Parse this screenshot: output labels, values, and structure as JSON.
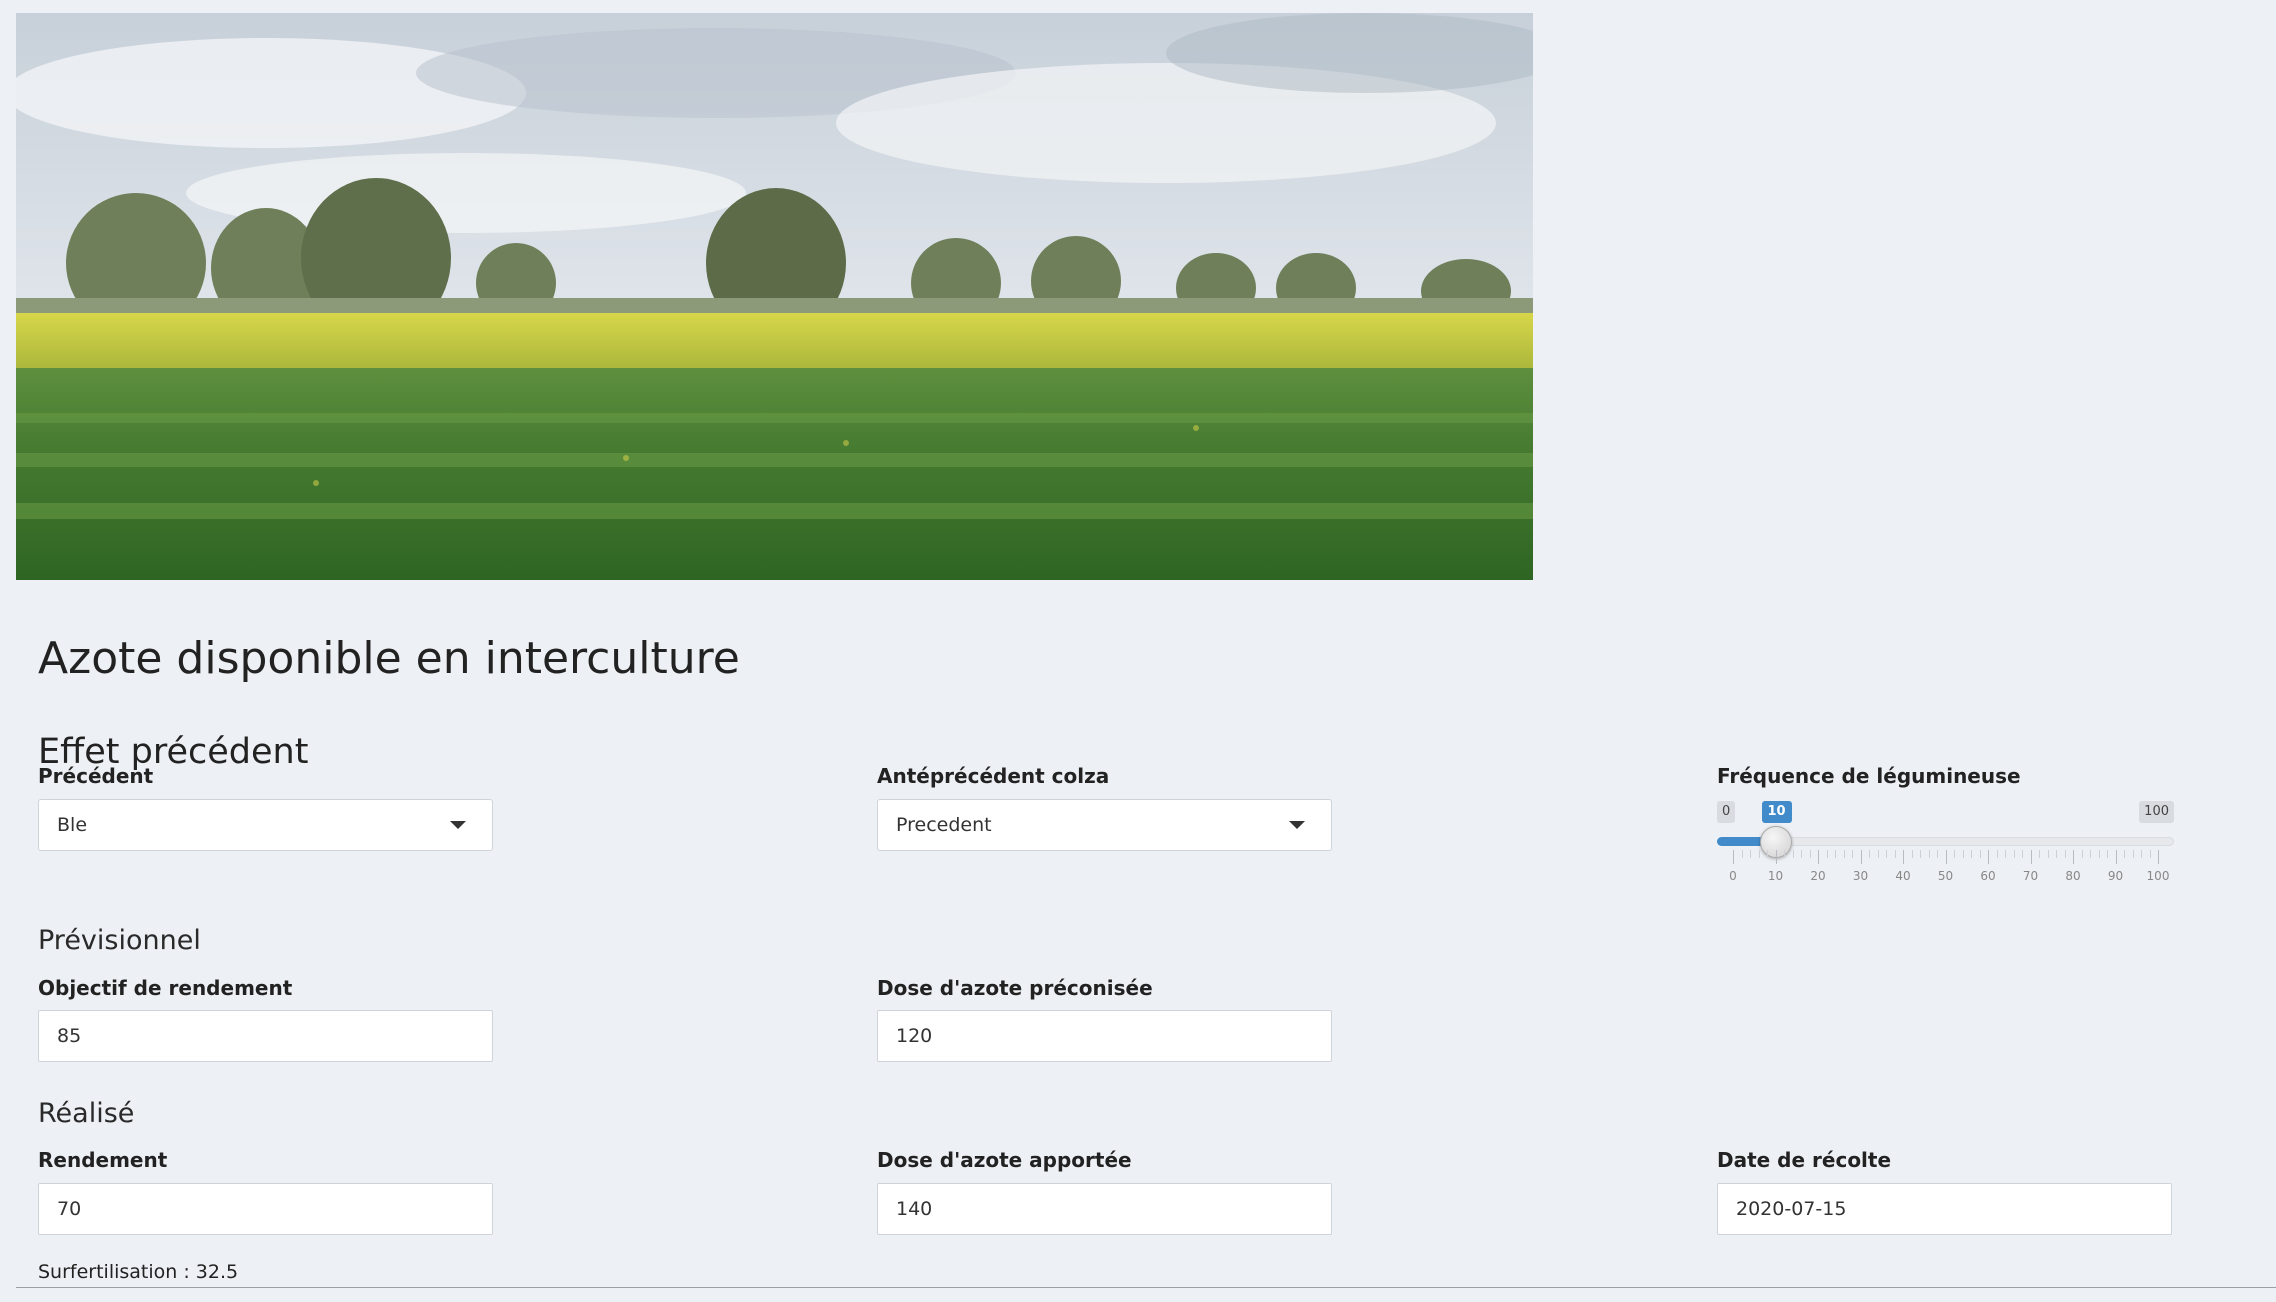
{
  "title": "Azote disponible en interculture",
  "precedent_section": {
    "title": "Effet précédent",
    "precedent": {
      "label": "Précédent",
      "value": "Ble"
    },
    "anteprecedent": {
      "label": "Antéprécédent colza",
      "value": "Precedent"
    },
    "legume_frequency": {
      "label": "Fréquence de légumineuse",
      "min": 0,
      "max": 100,
      "value": 10,
      "min_text": "0",
      "max_text": "100",
      "value_text": "10",
      "ticks": [
        "0",
        "10",
        "20",
        "30",
        "40",
        "50",
        "60",
        "70",
        "80",
        "90",
        "100"
      ]
    }
  },
  "previsionnel": {
    "title": "Prévisionnel",
    "objectif_rendement": {
      "label": "Objectif de rendement",
      "value": "85"
    },
    "dose_preconisee": {
      "label": "Dose d'azote préconisée",
      "value": "120"
    }
  },
  "realise": {
    "title": "Réalisé",
    "rendement": {
      "label": "Rendement",
      "value": "70"
    },
    "dose_apportee": {
      "label": "Dose d'azote apportée",
      "value": "140"
    },
    "date_recolte": {
      "label": "Date de récolte",
      "value": "2020-07-15"
    }
  },
  "surfertilisation": "Surfertilisation : 32.5",
  "colors": {
    "accent": "#428bca",
    "background": "#edf0f4"
  }
}
